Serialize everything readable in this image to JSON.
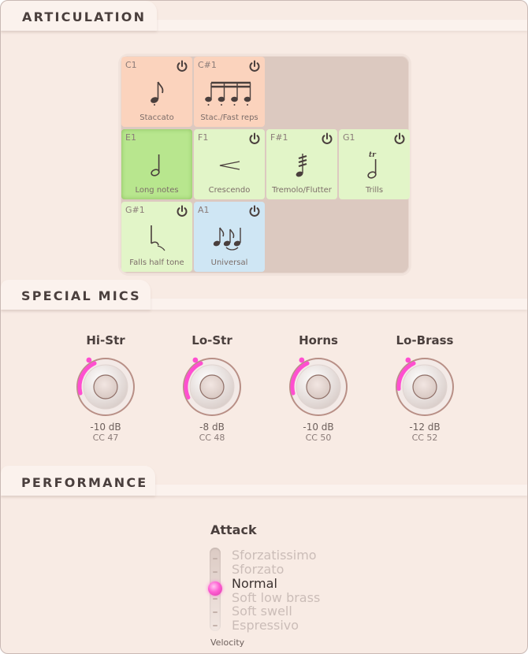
{
  "sections": {
    "articulation": "ARTICULATION",
    "special_mics": "SPECIAL MICS",
    "performance": "PERFORMANCE"
  },
  "articulations": [
    {
      "key": "C1",
      "label": "Staccato",
      "color": "orange",
      "icon": "eighth-note-icon"
    },
    {
      "key": "C#1",
      "label": "Stac./Fast reps",
      "color": "orange",
      "icon": "sixteenth-notes-icon"
    },
    {
      "key": "E1",
      "label": "Long notes",
      "color": "green-active",
      "icon": "half-note-icon"
    },
    {
      "key": "F1",
      "label": "Crescendo",
      "color": "green",
      "icon": "crescendo-icon"
    },
    {
      "key": "F#1",
      "label": "Tremolo/Flutter",
      "color": "green",
      "icon": "tremolo-icon"
    },
    {
      "key": "G1",
      "label": "Trills",
      "color": "green",
      "icon": "trill-icon"
    },
    {
      "key": "G#1",
      "label": "Falls half tone",
      "color": "green",
      "icon": "fall-icon"
    },
    {
      "key": "A1",
      "label": "Universal",
      "color": "blue",
      "icon": "universal-notes-icon"
    }
  ],
  "mics": [
    {
      "name": "Hi-Str",
      "db": "-10 dB",
      "cc": "CC 47",
      "level": 0.4
    },
    {
      "name": "Lo-Str",
      "db": "-8 dB",
      "cc": "CC 48",
      "level": 0.45
    },
    {
      "name": "Horns",
      "db": "-10 dB",
      "cc": "CC 50",
      "level": 0.4
    },
    {
      "name": "Lo-Brass",
      "db": "-12 dB",
      "cc": "CC 52",
      "level": 0.35
    }
  ],
  "attack": {
    "title": "Attack",
    "options": [
      "Sforzatissimo",
      "Sforzato",
      "Normal",
      "Soft low brass",
      "Soft swell",
      "Espressivo"
    ],
    "selected": "Normal",
    "footer": "Velocity"
  },
  "colors": {
    "accent": "#ff4fd0",
    "orange": "#fbd3bd",
    "green": "#e2f5c8",
    "green_active": "#b8e68e",
    "blue": "#cfe6f4"
  }
}
